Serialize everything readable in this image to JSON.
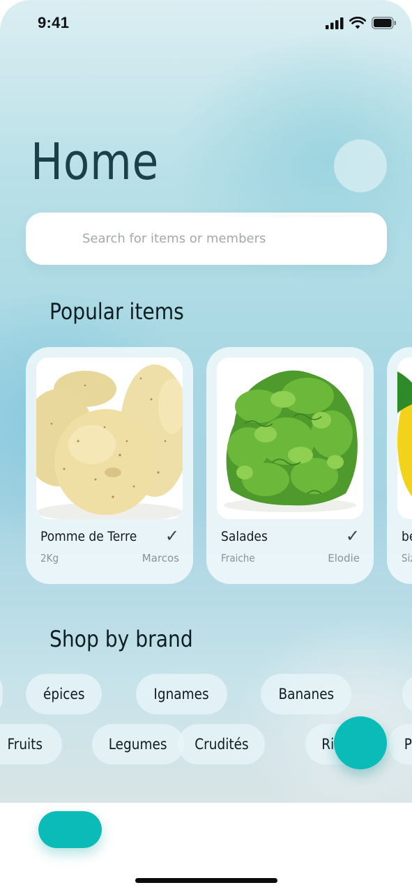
{
  "status_bar": {
    "time": "9:41"
  },
  "header": {
    "title": "Home"
  },
  "search": {
    "placeholder": "Search for items or members",
    "value": ""
  },
  "popular": {
    "title": "Popular items",
    "items": [
      {
        "name": "Pomme de Terre",
        "detail": "2Kg",
        "owner": "Marcos",
        "image_icon": "potato-image",
        "selected": true
      },
      {
        "name": "Salades",
        "detail": "Fraiche",
        "owner": "Elodie",
        "image_icon": "lettuce-image",
        "selected": true
      },
      {
        "name": "be",
        "detail": "Siz",
        "owner": "",
        "image_icon": "lemon-image",
        "selected": false
      }
    ]
  },
  "brands": {
    "title": "Shop by brand",
    "row1": [
      "épices",
      "Ignames",
      "Bananes"
    ],
    "row2": [
      "Fruits",
      "Legumes",
      "Crudités",
      "Ri",
      "P"
    ]
  },
  "colors": {
    "accent": "#0bbbb8",
    "title": "#1d3f4a",
    "text": "#111a1d",
    "muted": "#8a9397"
  }
}
